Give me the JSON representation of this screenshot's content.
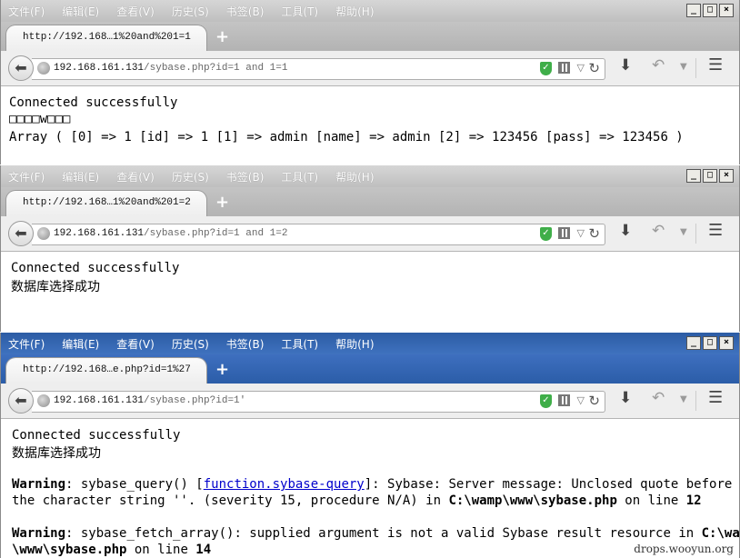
{
  "menu": [
    "文件(F)",
    "编辑(E)",
    "查看(V)",
    "历史(S)",
    "书签(B)",
    "工具(T)",
    "帮助(H)"
  ],
  "window_controls": [
    "_",
    "□",
    "×"
  ],
  "new_tab_label": "+",
  "icons": {
    "back": "arrow-left-icon",
    "globe": "globe-icon",
    "shield": "shield-icon",
    "qr": "qr-code-icon",
    "reload": "reload-icon",
    "download": "download-icon",
    "undo": "undo-icon",
    "menu": "hamburger-menu-icon"
  },
  "colors": {
    "inactive_titlebar": "#c4c4c4",
    "active_titlebar": "#2c5ca4",
    "link": "#0000cc"
  },
  "windows": [
    {
      "tab_title": "http://192.168…1%20and%201=1",
      "url_host": "192.168.161.131",
      "url_path": "/sybase.php?id=1 and 1=1",
      "content": {
        "line1": "Connected successfully",
        "line2": "□□□□w□□□",
        "line3": "Array ( [0] => 1 [id] => 1 [1] => admin [name] => admin [2] => 123456 [pass] => 123456 )"
      }
    },
    {
      "tab_title": "http://192.168…1%20and%201=2",
      "url_host": "192.168.161.131",
      "url_path": "/sybase.php?id=1 and 1=2",
      "content": {
        "line1": "Connected successfully",
        "line2": "数据库选择成功"
      }
    },
    {
      "tab_title": "http://192.168…e.php?id=1%27",
      "url_host": "192.168.161.131",
      "url_path": "/sybase.php?id=1'",
      "content": {
        "line1": "Connected successfully",
        "line2": "数据库选择成功",
        "warn1": {
          "label": "Warning",
          "t1": ": sybase_query() [",
          "link": "function.sybase-query",
          "t2": "]: Sybase: Server message: Unclosed quote before",
          "t3": "the character string ''. (severity 15, procedure N/A) in ",
          "path": "C:\\wamp\\www\\sybase.php",
          "t4": " on line ",
          "line_no": "12"
        },
        "warn2": {
          "label": "Warning",
          "t1": ": sybase_fetch_array(): supplied argument is not a valid Sybase result resource in ",
          "path1": "C:\\wamp",
          "path2": "\\www\\sybase.php",
          "t2": " on line ",
          "line_no": "14"
        }
      }
    }
  ],
  "watermark": "drops.wooyun.org"
}
